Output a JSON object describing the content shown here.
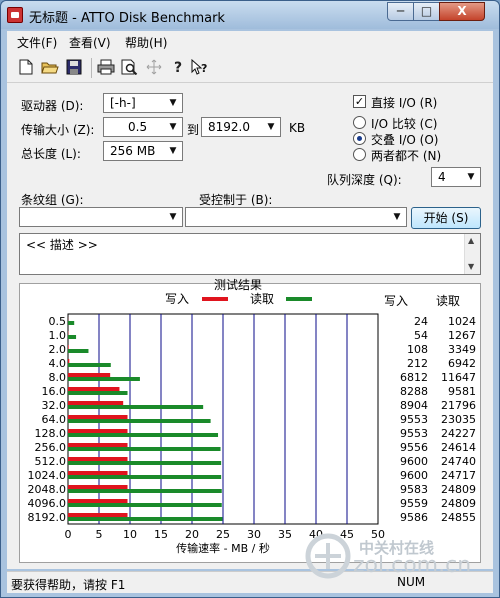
{
  "window": {
    "title": "无标题 - ATTO Disk Benchmark",
    "controls": {
      "minimize": "─",
      "maximize": "□",
      "close": "X"
    }
  },
  "menu": [
    "文件(F)",
    "查看(V)",
    "帮助(H)"
  ],
  "toolbar": [
    "new-icon",
    "open-icon",
    "save-icon",
    "print-icon",
    "print-preview-icon",
    "move-icon",
    "help-icon",
    "context-help-icon"
  ],
  "form": {
    "drive_label": "驱动器 (D):",
    "drive_value": "[-h-]",
    "transfer_label": "传输大小 (Z):",
    "transfer_from": "0.5",
    "to_label": "到",
    "transfer_to": "8192.0",
    "kb_label": "KB",
    "length_label": "总长度 (L):",
    "length_value": "256 MB",
    "direct_io_label": "直接 I/O (R)",
    "direct_io_checked": true,
    "io_compare_label": "I/O 比较 (C)",
    "overlapped_io_label": "交叠 I/O (O)",
    "neither_label": "两者都不 (N)",
    "queue_depth_label": "队列深度 (Q):",
    "queue_depth_value": "4",
    "stripe_label": "条纹组 (G):",
    "controlled_by_label": "受控制于 (B):",
    "start_button": "开始 (S)",
    "description": "<< 描述 >>"
  },
  "results_header": {
    "title": "测试结果",
    "write_label": "写入",
    "read_label": "读取",
    "col_write": "写入",
    "col_read": "读取"
  },
  "chart_data": {
    "type": "bar",
    "title": "测试结果",
    "xlabel": "传输速率 - MB / 秒",
    "ylabel": "",
    "xlim": [
      0,
      50
    ],
    "x_ticks": [
      "0",
      "5",
      "10",
      "15",
      "20",
      "25",
      "30",
      "35",
      "40",
      "45",
      "50"
    ],
    "legend_placement": "top",
    "grid": true,
    "categories": [
      "0.5",
      "1.0",
      "2.0",
      "4.0",
      "8.0",
      "16.0",
      "32.0",
      "64.0",
      "128.0",
      "256.0",
      "512.0",
      "1024.0",
      "2048.0",
      "4096.0",
      "8192.0"
    ],
    "series": [
      {
        "name": "写入",
        "color": "#e0141e",
        "values_mb": [
          0.02,
          0.05,
          0.11,
          0.21,
          6.8,
          8.3,
          8.9,
          9.6,
          9.6,
          9.6,
          9.6,
          9.6,
          9.6,
          9.6,
          9.6
        ],
        "values_kb": [
          24,
          54,
          108,
          212,
          6812,
          8288,
          8904,
          9553,
          9553,
          9556,
          9600,
          9600,
          9583,
          9559,
          9586
        ]
      },
      {
        "name": "读取",
        "color": "#1a8a2a",
        "values_mb": [
          1.0,
          1.3,
          3.3,
          6.9,
          11.6,
          9.6,
          21.8,
          23.0,
          24.2,
          24.6,
          24.7,
          24.7,
          24.8,
          24.8,
          24.9
        ],
        "values_kb": [
          1024,
          1267,
          3349,
          6942,
          11647,
          9581,
          21796,
          23035,
          24227,
          24614,
          24740,
          24717,
          24809,
          24809,
          24855
        ]
      }
    ]
  },
  "status": {
    "help_text": "要获得帮助，请按 F1",
    "num": "NUM"
  },
  "watermark": {
    "cn": "中关村在线",
    "en": "zol.com.cn"
  },
  "colors": {
    "write": "#e0141e",
    "read": "#1a8a2a",
    "grid": "#0a0a8a",
    "titlebar": "#a9c3df"
  }
}
